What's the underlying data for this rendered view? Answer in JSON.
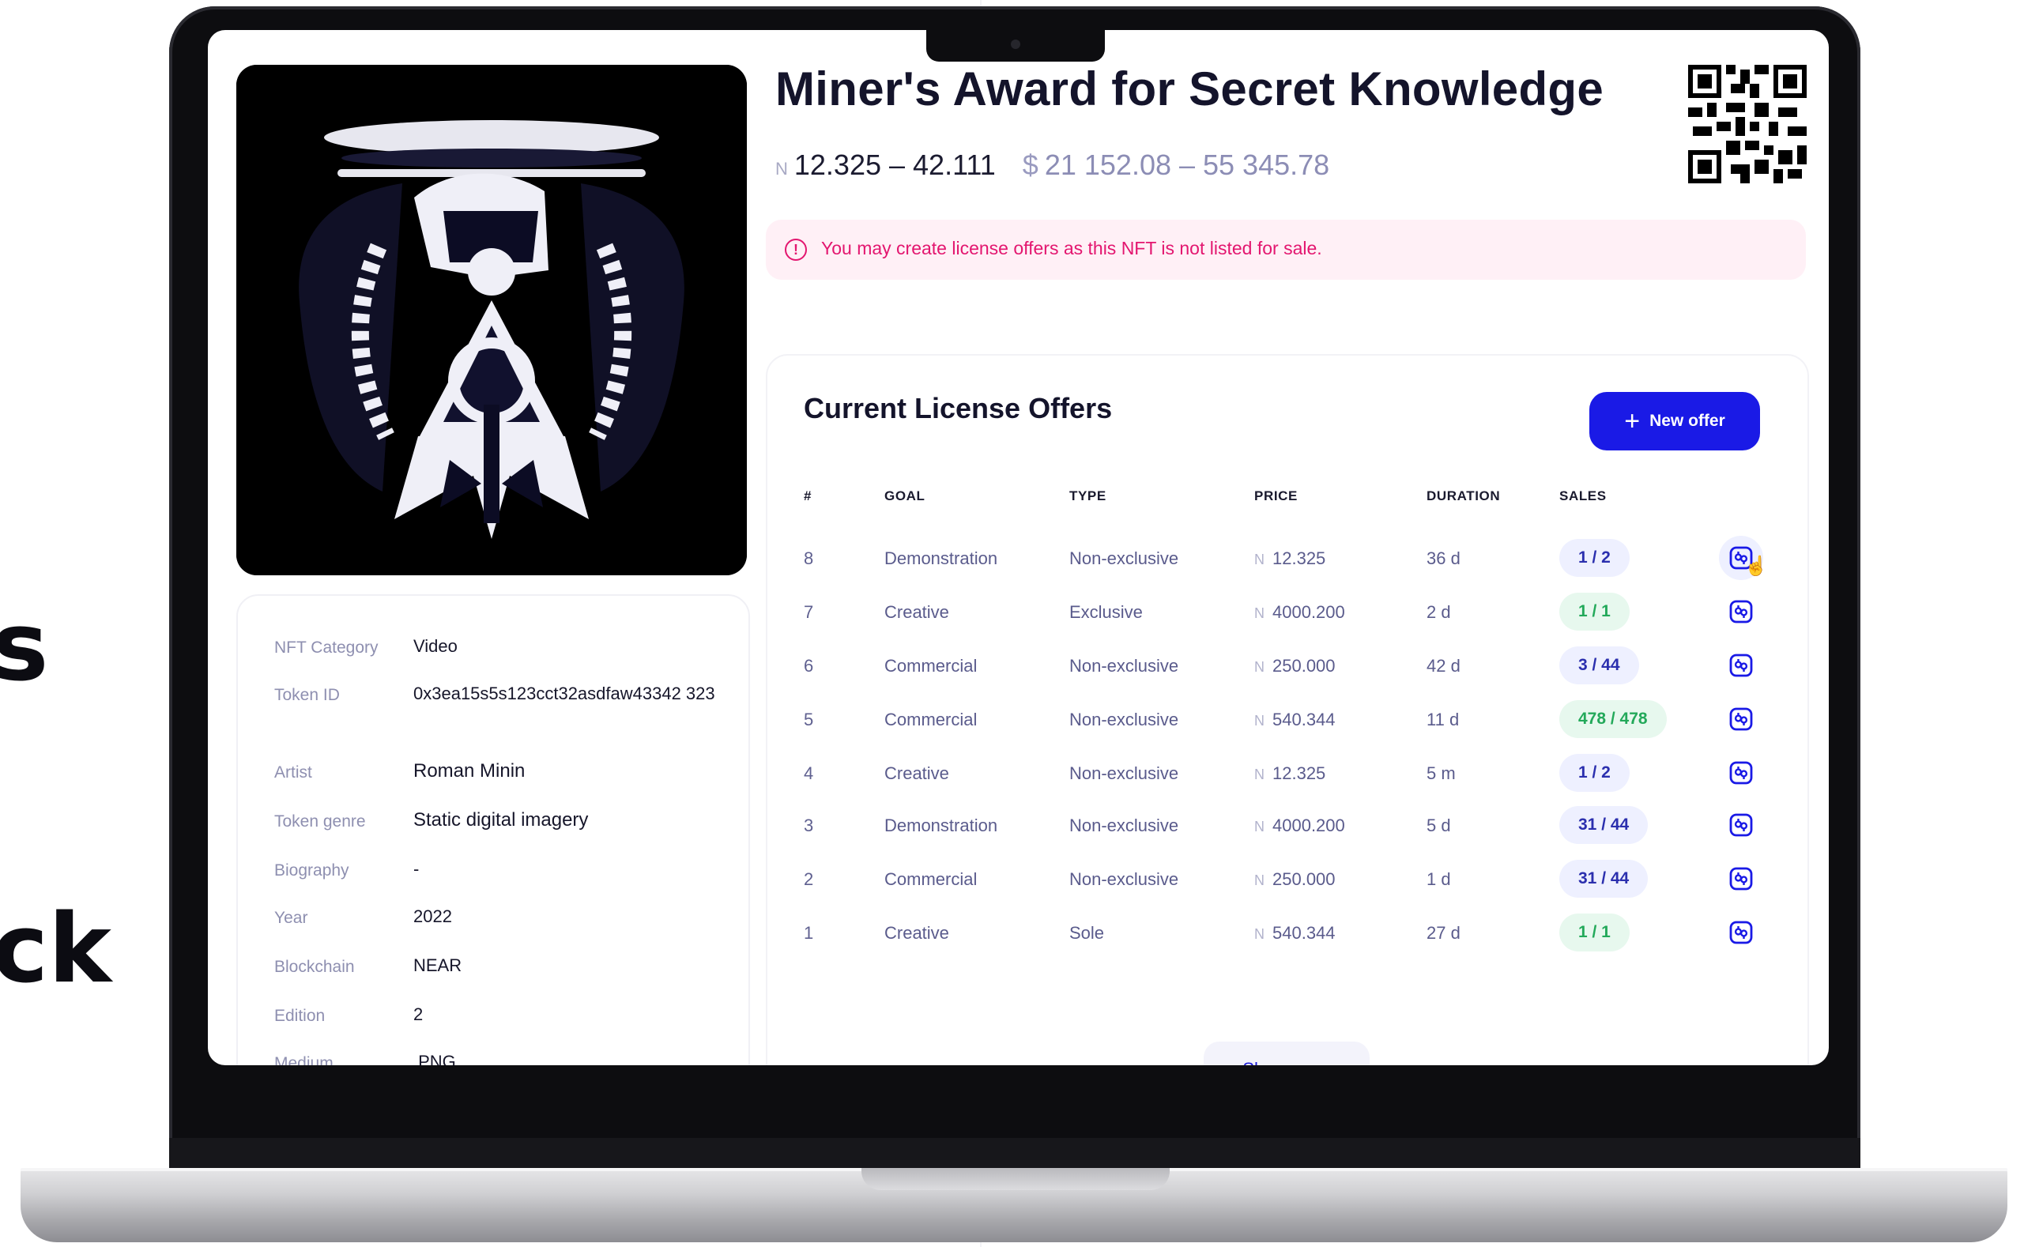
{
  "background": {
    "text_fragments": [
      "s",
      "ck"
    ]
  },
  "nft": {
    "title": "Miner's Award for Secret Knowledge",
    "near_symbol": "N",
    "near_range": "12.325 – 42.111",
    "usd_symbol": "$",
    "usd_range": "21 152.08 – 55 345.78",
    "alert_icon": "!",
    "alert": "You may create license offers as this NFT is not listed for sale."
  },
  "details": [
    {
      "label": "NFT Category",
      "value": "Video"
    },
    {
      "label": "Token ID",
      "value": "0x3ea15s5s123cct32asdfaw43342 323"
    },
    {
      "label": "Artist",
      "value": "Roman Minin"
    },
    {
      "label": "Token genre",
      "value": "Static digital imagery"
    },
    {
      "label": "Biography",
      "value": "-"
    },
    {
      "label": "Year",
      "value": "2022"
    },
    {
      "label": "Blockchain",
      "value": "NEAR"
    },
    {
      "label": "Edition",
      "value": "2"
    },
    {
      "label": "Medium",
      "value": ".PNG"
    }
  ],
  "offers": {
    "title": "Current License Offers",
    "new_offer_plus": "+",
    "new_offer_label": "New offer",
    "columns": {
      "num": "#",
      "goal": "GOAL",
      "type": "TYPE",
      "price": "PRICE",
      "duration": "DURATION",
      "sales": "SALES"
    },
    "rows": [
      {
        "num": "8",
        "goal": "Demonstration",
        "type": "Non-exclusive",
        "price": "12.325",
        "duration": "36 d",
        "sales": "1 / 2",
        "sales_status": "blue"
      },
      {
        "num": "7",
        "goal": "Creative",
        "type": "Exclusive",
        "price": "4000.200",
        "duration": "2 d",
        "sales": "1 / 1",
        "sales_status": "green"
      },
      {
        "num": "6",
        "goal": "Commercial",
        "type": "Non-exclusive",
        "price": "250.000",
        "duration": "42 d",
        "sales": "3 / 44",
        "sales_status": "blue"
      },
      {
        "num": "5",
        "goal": "Commercial",
        "type": "Non-exclusive",
        "price": "540.344",
        "duration": "11 d",
        "sales": "478 / 478",
        "sales_status": "green"
      },
      {
        "num": "4",
        "goal": "Creative",
        "type": "Non-exclusive",
        "price": "12.325",
        "duration": "5 m",
        "sales": "1 / 2",
        "sales_status": "blue"
      },
      {
        "num": "3",
        "goal": "Demonstration",
        "type": "Non-exclusive",
        "price": "4000.200",
        "duration": "5 d",
        "sales": "31 / 44",
        "sales_status": "blue"
      },
      {
        "num": "2",
        "goal": "Commercial",
        "type": "Non-exclusive",
        "price": "250.000",
        "duration": "1 d",
        "sales": "31 / 44",
        "sales_status": "blue"
      },
      {
        "num": "1",
        "goal": "Creative",
        "type": "Sole",
        "price": "540.344",
        "duration": "27 d",
        "sales": "1 / 1",
        "sales_status": "green"
      }
    ],
    "row_icon": "license-icon",
    "show_more": "Show more"
  },
  "colors": {
    "accent": "#1a1ae6",
    "alert_text": "#e3166f",
    "alert_bg": "#fff0f6",
    "title": "#14142b"
  }
}
